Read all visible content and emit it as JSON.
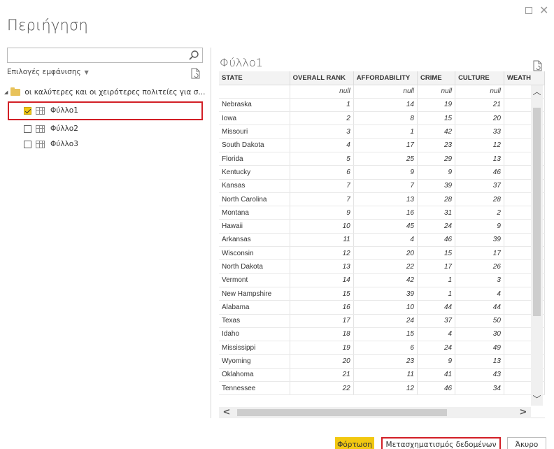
{
  "window": {
    "title": "Περιήγηση"
  },
  "search": {
    "placeholder": ""
  },
  "display_options": {
    "label": "Επιλογές εμφάνισης"
  },
  "tree": {
    "root_label": "οι καλύτερες και οι χειρότερες πολιτείες για σ...",
    "items": [
      {
        "label": "Φύλλο1",
        "checked": true
      },
      {
        "label": "Φύλλο2",
        "checked": false
      },
      {
        "label": "Φύλλο3",
        "checked": false
      }
    ]
  },
  "preview": {
    "title": "Φύλλο1",
    "columns": [
      "STATE",
      "OVERALL RANK",
      "AFFORDABILITY",
      "CRIME",
      "CULTURE",
      "WEATH"
    ],
    "rows": [
      [
        "",
        "null",
        "null",
        "null",
        "null",
        ""
      ],
      [
        "Nebraska",
        "1",
        "14",
        "19",
        "21",
        ""
      ],
      [
        "Iowa",
        "2",
        "8",
        "15",
        "20",
        ""
      ],
      [
        "Missouri",
        "3",
        "1",
        "42",
        "33",
        ""
      ],
      [
        "South Dakota",
        "4",
        "17",
        "23",
        "12",
        ""
      ],
      [
        "Florida",
        "5",
        "25",
        "29",
        "13",
        ""
      ],
      [
        "Kentucky",
        "6",
        "9",
        "9",
        "46",
        ""
      ],
      [
        "Kansas",
        "7",
        "7",
        "39",
        "37",
        ""
      ],
      [
        "North Carolina",
        "7",
        "13",
        "28",
        "28",
        ""
      ],
      [
        "Montana",
        "9",
        "16",
        "31",
        "2",
        ""
      ],
      [
        "Hawaii",
        "10",
        "45",
        "24",
        "9",
        ""
      ],
      [
        "Arkansas",
        "11",
        "4",
        "46",
        "39",
        ""
      ],
      [
        "Wisconsin",
        "12",
        "20",
        "15",
        "17",
        ""
      ],
      [
        "North Dakota",
        "13",
        "22",
        "17",
        "26",
        ""
      ],
      [
        "Vermont",
        "14",
        "42",
        "1",
        "3",
        ""
      ],
      [
        "New Hampshire",
        "15",
        "39",
        "1",
        "4",
        ""
      ],
      [
        "Alabama",
        "16",
        "10",
        "44",
        "44",
        ""
      ],
      [
        "Texas",
        "17",
        "24",
        "37",
        "50",
        ""
      ],
      [
        "Idaho",
        "18",
        "15",
        "4",
        "30",
        ""
      ],
      [
        "Mississippi",
        "19",
        "6",
        "24",
        "49",
        ""
      ],
      [
        "Wyoming",
        "20",
        "23",
        "9",
        "13",
        ""
      ],
      [
        "Oklahoma",
        "21",
        "11",
        "41",
        "43",
        ""
      ],
      [
        "Tennessee",
        "22",
        "12",
        "46",
        "34",
        ""
      ]
    ]
  },
  "footer": {
    "load_label": "Φόρτωση",
    "transform_label": "Μετασχηματισμός δεδομένων",
    "cancel_label": "Άκυρο"
  },
  "colors": {
    "accent": "#f2c811",
    "highlight_border": "#d21f26"
  }
}
